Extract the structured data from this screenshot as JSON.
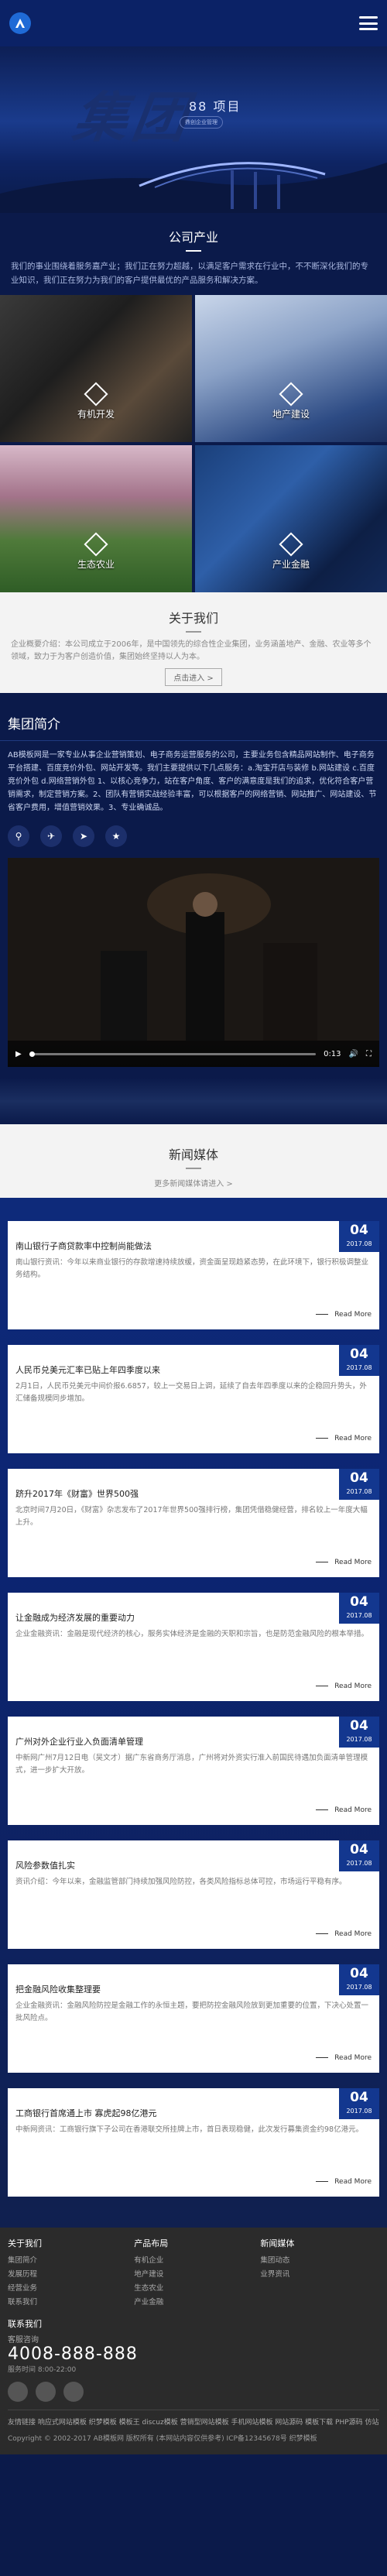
{
  "hero": {
    "calligraphy": "集团",
    "sub": "88 项目",
    "tag": "鼎创企业管理"
  },
  "industry": {
    "title": "公司产业",
    "intro": "我们的事业围绕着服务嘉产业；我们正在努力超越，以满足客户需求在行业中，不不断深化我们的专业知识，我们正在努力为我们的客户提供最优的产品服务和解决方案。",
    "items": [
      {
        "label": "有机开发"
      },
      {
        "label": "地产建设"
      },
      {
        "label": "生态农业"
      },
      {
        "label": "产业金融"
      }
    ]
  },
  "about": {
    "title": "关于我们",
    "text": "企业概要介绍：本公司成立于2006年，是中国领先的综合性企业集团，业务涵盖地产、金融、农业等多个领域，致力于为客户创造价值，集团始终坚持以人为本。",
    "more": "点击进入 >"
  },
  "group": {
    "title": "集团简介",
    "text": "AB模板网是一家专业从事企业营销策划、电子商务运营服务的公司，主要业务包含精品网站制作、电子商务平台搭建、百度竞价外包、网站开发等。我们主要提供以下几点服务：a.淘宝开店与装修 b.网站建设 c.百度竞价外包 d.网络营销外包 1、以核心竞争力，站在客户角度、客户的满意度是我们的追求，优化符合客户营销需求，制定营销方案。2、团队有营销实战经验丰富，可以根据客户的网络营销、网站推广、网站建设、节省客户费用，增值营销效果。3、专业确诚品。",
    "social_icons": [
      "link-icon",
      "share-icon",
      "send-icon",
      "star-icon"
    ]
  },
  "video": {
    "time": "0:13"
  },
  "news": {
    "title": "新闻媒体",
    "sub": "更多新闻媒体请进入 >",
    "read_more": "Read More",
    "items": [
      {
        "day": "04",
        "ym": "2017.08",
        "title": "南山银行子商贷款率中控制尚能做法",
        "desc": "南山银行资讯：今年以来商业银行的存款增速持续放缓，资金面呈现趋紧态势，在此环境下，银行积极调整业务结构。"
      },
      {
        "day": "04",
        "ym": "2017.08",
        "title": "人民币兑美元汇率已贴上年四季度以来",
        "desc": "2月1日，人民币兑美元中间价报6.6857，较上一交易日上调，延续了自去年四季度以来的企稳回升势头，外汇储备规模同步增加。"
      },
      {
        "day": "04",
        "ym": "2017.08",
        "title": "跻升2017年《财富》世界500强",
        "desc": "北京时间7月20日，《财富》杂志发布了2017年世界500强排行榜，集团凭借稳健经营，排名较上一年度大幅上升。"
      },
      {
        "day": "04",
        "ym": "2017.08",
        "title": "让金融成为经济发展的重要动力",
        "desc": "企业金融资讯：金融是现代经济的核心，服务实体经济是金融的天职和宗旨，也是防范金融风险的根本举措。"
      },
      {
        "day": "04",
        "ym": "2017.08",
        "title": "广州对外企业行业入负面清单管理",
        "desc": "中新网广州7月12日电（吴文才）据广东省商务厅消息，广州将对外资实行准入前国民待遇加负面清单管理模式，进一步扩大开放。"
      },
      {
        "day": "04",
        "ym": "2017.08",
        "title": "风险参数值扎实",
        "desc": "资讯介绍：今年以来，金融监管部门持续加强风险防控，各类风险指标总体可控，市场运行平稳有序。"
      },
      {
        "day": "04",
        "ym": "2017.08",
        "title": "把金融风险收集整理要",
        "desc": "企业金融资讯：金融风险防控是金融工作的永恒主题，要把防控金融风险放到更加重要的位置，下决心处置一批风险点。"
      },
      {
        "day": "04",
        "ym": "2017.08",
        "title": "工商银行首席通上市 寡虎起98亿港元",
        "desc": "中新网资讯：工商银行旗下子公司在香港联交所挂牌上市，首日表现稳健，此次发行募集资金约98亿港元。"
      }
    ]
  },
  "footer": {
    "cols": [
      {
        "title": "关于我们",
        "links": [
          "集团简介",
          "发展历程",
          "经营业务",
          "联系我们"
        ]
      },
      {
        "title": "产品布局",
        "links": [
          "有机企业",
          "地产建设",
          "生态农业",
          "产业金融"
        ]
      },
      {
        "title": "新闻媒体",
        "links": [
          "集团动态",
          "业界资讯",
          "",
          ""
        ]
      }
    ],
    "contact_title": "联系我们",
    "service_title": "客服咨询",
    "phone": "4008-888-888",
    "hours": "服务时间 8:00-22:00",
    "links": "友情链接  响应式网站模板  织梦模板  模板王  discuz模板  营销型网站模板  手机网站模板  网站源码  模板下载  PHP源码  仿站",
    "copy": "Copyright © 2002-2017 AB模板网 版权所有 (本网站内容仅供参考)  ICP备12345678号  织梦模板"
  }
}
